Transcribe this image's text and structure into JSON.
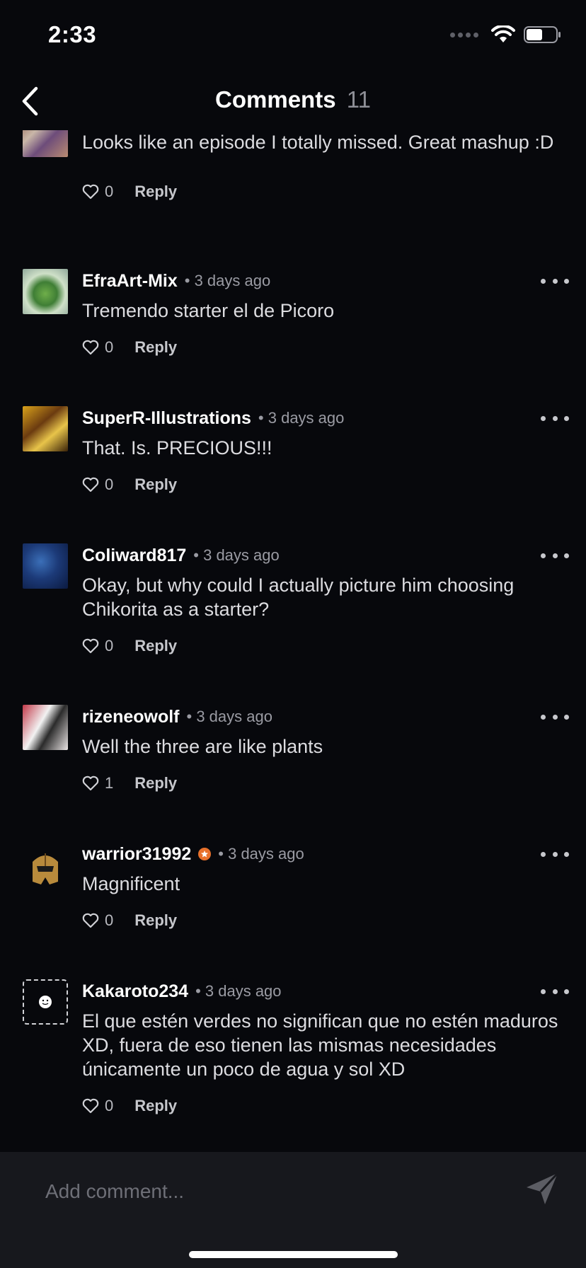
{
  "status_bar": {
    "time": "2:33"
  },
  "header": {
    "title": "Comments",
    "count": "11"
  },
  "comments": [
    {
      "author": "",
      "meta": "",
      "body": "Looks like an episode I totally missed. Great mashup :D",
      "likes": "0",
      "reply": "Reply"
    },
    {
      "author": "EfraArt-Mix",
      "meta": "• 3 days ago",
      "body": "Tremendo starter el de Picoro",
      "likes": "0",
      "reply": "Reply"
    },
    {
      "author": "SuperR-Illustrations",
      "meta": "• 3 days ago",
      "body": "That. Is. PRECIOUS!!!",
      "likes": "0",
      "reply": "Reply"
    },
    {
      "author": "Coliward817",
      "meta": "• 3 days ago",
      "body": "Okay, but why could I actually picture him choosing Chikorita as a starter?",
      "likes": "0",
      "reply": "Reply"
    },
    {
      "author": "rizeneowolf",
      "meta": "• 3 days ago",
      "body": "Well the three are like plants",
      "likes": "1",
      "reply": "Reply"
    },
    {
      "author": "warrior31992",
      "meta": "• 3 days ago",
      "body": "Magnificent",
      "likes": "0",
      "reply": "Reply"
    },
    {
      "author": "Kakaroto234",
      "meta": "• 3 days ago",
      "body": "El que estén verdes no significan que no estén maduros XD, fuera de eso tienen las mismas necesidades únicamente un poco de agua y sol XD",
      "likes": "0",
      "reply": "Reply"
    }
  ],
  "composer": {
    "placeholder": "Add comment..."
  },
  "colors": {
    "background": "#07080c",
    "composer": "#17181d",
    "badge": "#e8712b",
    "muted": "#9a9ba3"
  },
  "icons": [
    "back-chevron-icon",
    "wifi-icon",
    "battery-icon",
    "heart-icon",
    "more-dots-icon",
    "send-icon",
    "star-badge-icon"
  ]
}
